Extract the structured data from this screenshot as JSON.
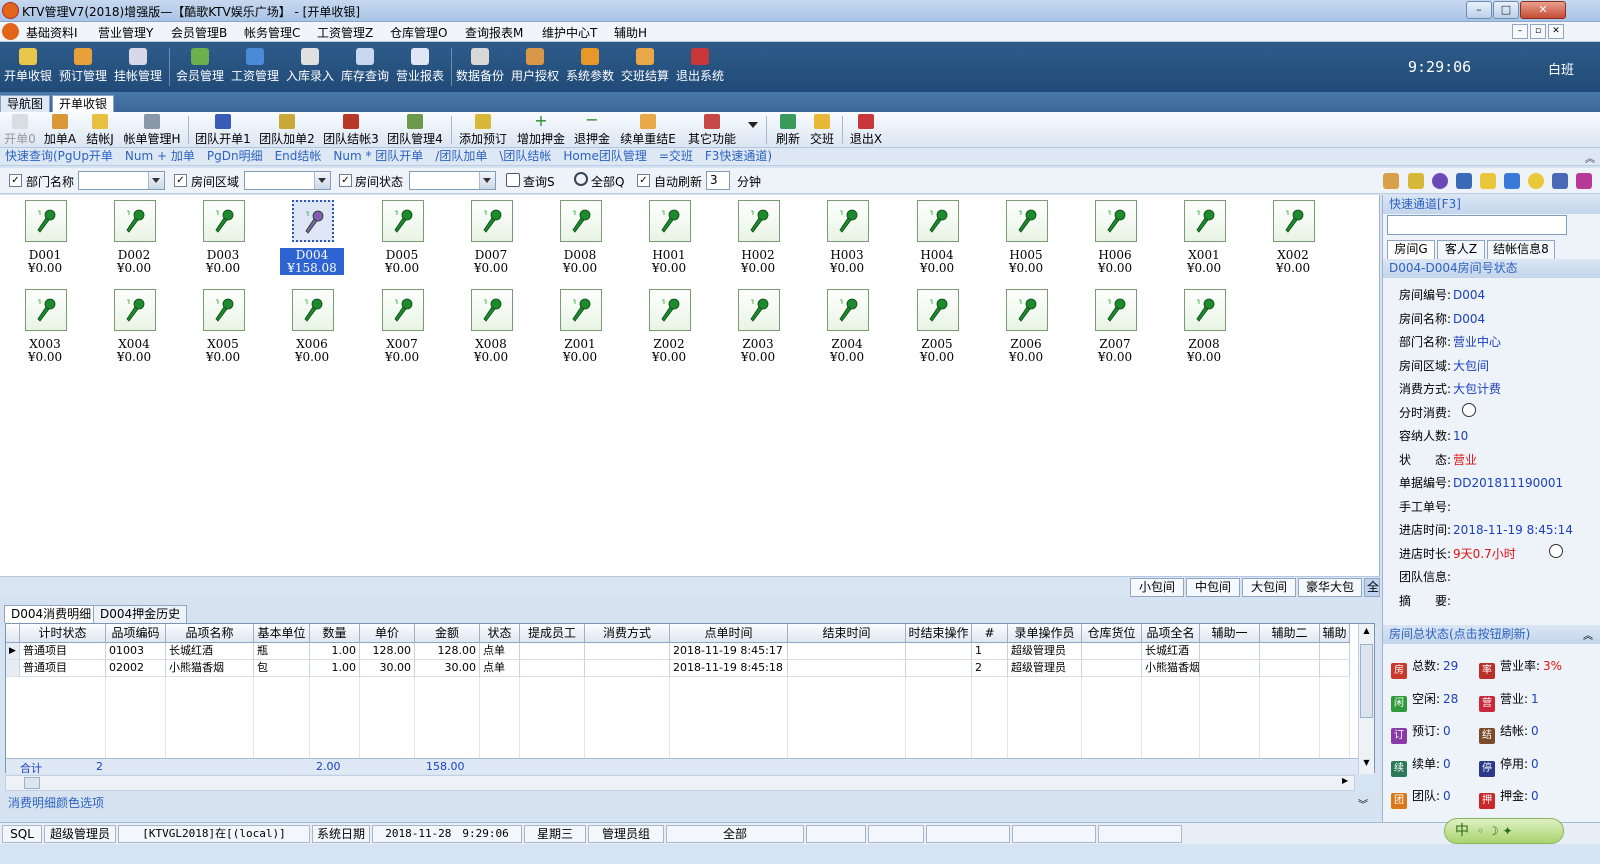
{
  "window": {
    "title": "KTV管理V7(2018)增强版—【酷歌KTV娱乐广场】 - [开单收银]"
  },
  "menu": [
    "基础资料I",
    "营业管理Y",
    "会员管理B",
    "帐务管理C",
    "工资管理Z",
    "仓库管理O",
    "查询报表M",
    "维护中心T",
    "辅助H"
  ],
  "toolbar": [
    {
      "label": "开单收银",
      "color": "#e8c84a"
    },
    {
      "label": "预订管理",
      "color": "#e8a13a"
    },
    {
      "label": "挂帐管理",
      "color": "#d8d8e8"
    },
    {
      "label": "会员管理",
      "color": "#6ab04c"
    },
    {
      "label": "工资管理",
      "color": "#4a8ad8"
    },
    {
      "label": "入库录入",
      "color": "#e0e0e0"
    },
    {
      "label": "库存查询",
      "color": "#c8d8f0"
    },
    {
      "label": "营业报表",
      "color": "#e0e8f8"
    },
    {
      "label": "数据备份",
      "color": "#d8d8d8"
    },
    {
      "label": "用户授权",
      "color": "#d89848"
    },
    {
      "label": "系统参数",
      "color": "#e89828"
    },
    {
      "label": "交班结算",
      "color": "#e8a848"
    },
    {
      "label": "退出系统",
      "color": "#c83838"
    }
  ],
  "clock": "9:29:06",
  "shift": "白班",
  "tabs": {
    "nav": "导航图",
    "cashier": "开单收银"
  },
  "toolbar2": [
    "开单0",
    "加单A",
    "结帐J",
    "帐单管理H",
    "团队开单1",
    "团队加单2",
    "团队结帐3",
    "团队管理4",
    "添加预订",
    "增加押金",
    "退押金",
    "续单重结E",
    "其它功能",
    "刷新",
    "交班",
    "退出X"
  ],
  "hint": "快速查询(PgUp开单　Num + 加单　PgDn明细　End结帐　Num * 团队开单　/团队加单　\\团队结帐　Home团队管理　=交班　F3快速通道)",
  "filter": {
    "dept": "部门名称",
    "area": "房间区域",
    "status": "房间状态",
    "query": "查询S",
    "all": "全部Q",
    "auto": "自动刷新",
    "interval": "3",
    "minute": "分钟"
  },
  "rooms": [
    {
      "name": "D001",
      "price": "¥0.00"
    },
    {
      "name": "D002",
      "price": "¥0.00"
    },
    {
      "name": "D003",
      "price": "¥0.00"
    },
    {
      "name": "D004",
      "price": "¥158.08",
      "selected": true
    },
    {
      "name": "D005",
      "price": "¥0.00"
    },
    {
      "name": "D007",
      "price": "¥0.00"
    },
    {
      "name": "D008",
      "price": "¥0.00"
    },
    {
      "name": "H001",
      "price": "¥0.00"
    },
    {
      "name": "H002",
      "price": "¥0.00"
    },
    {
      "name": "H003",
      "price": "¥0.00"
    },
    {
      "name": "H004",
      "price": "¥0.00"
    },
    {
      "name": "H005",
      "price": "¥0.00"
    },
    {
      "name": "H006",
      "price": "¥0.00"
    },
    {
      "name": "X001",
      "price": "¥0.00"
    },
    {
      "name": "X002",
      "price": "¥0.00"
    },
    {
      "name": "X003",
      "price": "¥0.00"
    },
    {
      "name": "X004",
      "price": "¥0.00"
    },
    {
      "name": "X005",
      "price": "¥0.00"
    },
    {
      "name": "X006",
      "price": "¥0.00"
    },
    {
      "name": "X007",
      "price": "¥0.00"
    },
    {
      "name": "X008",
      "price": "¥0.00"
    },
    {
      "name": "Z001",
      "price": "¥0.00"
    },
    {
      "name": "Z002",
      "price": "¥0.00"
    },
    {
      "name": "Z003",
      "price": "¥0.00"
    },
    {
      "name": "Z004",
      "price": "¥0.00"
    },
    {
      "name": "Z005",
      "price": "¥0.00"
    },
    {
      "name": "Z006",
      "price": "¥0.00"
    },
    {
      "name": "Z007",
      "price": "¥0.00"
    },
    {
      "name": "Z008",
      "price": "¥0.00"
    }
  ],
  "roomTabs": [
    "小包间",
    "中包间",
    "大包间",
    "豪华大包",
    "全部"
  ],
  "bottomTabs": [
    "D004消费明细",
    "D004押金历史"
  ],
  "grid": {
    "columns": [
      "计时状态",
      "品项编码",
      "品项名称",
      "基本单位",
      "数量",
      "单价",
      "金额",
      "状态",
      "提成员工",
      "消费方式",
      "点单时间",
      "结束时间",
      "时结束操作",
      "#",
      "录单操作员",
      "仓库货位",
      "品项全名",
      "辅助一",
      "辅助二",
      "辅助"
    ],
    "rows": [
      [
        "普通项目",
        "01003",
        "长城红酒",
        "瓶",
        "1.00",
        "128.00",
        "128.00",
        "点单",
        "",
        "",
        "2018-11-19 8:45:17",
        "",
        "",
        "1",
        "超级管理员",
        "",
        "长城红酒",
        "",
        "",
        ""
      ],
      [
        "普通项目",
        "02002",
        "小熊猫香烟",
        "包",
        "1.00",
        "30.00",
        "30.00",
        "点单",
        "",
        "",
        "2018-11-19 8:45:18",
        "",
        "",
        "2",
        "超级管理员",
        "",
        "小熊猫香烟",
        "",
        "",
        ""
      ]
    ],
    "sum": {
      "label": "合计",
      "count": "2",
      "qty": "2.00",
      "amount": "158.00"
    }
  },
  "colorbar": "消费明细颜色选项",
  "right": {
    "channel": "快速通道[F3]",
    "tabs": [
      "房间G",
      "客人Z",
      "结帐信息8"
    ],
    "roomHeader": "D004-D004房间号状态",
    "info": [
      {
        "k": "房间编号:",
        "v": "D004"
      },
      {
        "k": "房间名称:",
        "v": "D004"
      },
      {
        "k": "部门名称:",
        "v": "营业中心"
      },
      {
        "k": "房间区域:",
        "v": "大包间"
      },
      {
        "k": "消费方式:",
        "v": "大包计费"
      },
      {
        "k": "分时消费:",
        "v": ""
      },
      {
        "k": "容纳人数:",
        "v": "10"
      },
      {
        "k": "状　　态:",
        "v": "营业",
        "red": true
      },
      {
        "k": "单据编号:",
        "v": "DD201811190001"
      },
      {
        "k": "手工单号:",
        "v": ""
      },
      {
        "k": "进店时间:",
        "v": "2018-11-19 8:45:14"
      },
      {
        "k": "进店时长:",
        "v": "9天0.7小时",
        "red": true
      },
      {
        "k": "团队信息:",
        "v": ""
      },
      {
        "k": "摘　　要:",
        "v": ""
      }
    ],
    "statusHeader": "房间总状态(点击按钮刷新)",
    "stats": [
      {
        "k": "总数:",
        "v": "29",
        "color": "#c83a2a",
        "icon": "房"
      },
      {
        "k": "营业率:",
        "v": "3%",
        "red": true,
        "color": "#b83028",
        "icon": "率"
      },
      {
        "k": "空闲:",
        "v": "28",
        "color": "#2f9a3a",
        "icon": "闲"
      },
      {
        "k": "营业:",
        "v": "1",
        "color": "#c8283a",
        "icon": "营"
      },
      {
        "k": "预订:",
        "v": "0",
        "color": "#8a3aa8",
        "icon": "订"
      },
      {
        "k": "结帐:",
        "v": "0",
        "color": "#7a4a2a",
        "icon": "结"
      },
      {
        "k": "续单:",
        "v": "0",
        "color": "#2a7a5a",
        "icon": "续"
      },
      {
        "k": "停用:",
        "v": "0",
        "color": "#2a3a8a",
        "icon": "停"
      },
      {
        "k": "团队:",
        "v": "0",
        "color": "#d87818",
        "icon": "团"
      },
      {
        "k": "押金:",
        "v": "0",
        "color": "#c82828",
        "icon": "押"
      }
    ]
  },
  "status": [
    "SQL",
    "超级管理员",
    "[KTVGL2018]在[(local)]",
    "系统日期",
    "2018-11-28　9:29:06",
    "星期三",
    "管理员组",
    "全部"
  ],
  "ime": "中"
}
